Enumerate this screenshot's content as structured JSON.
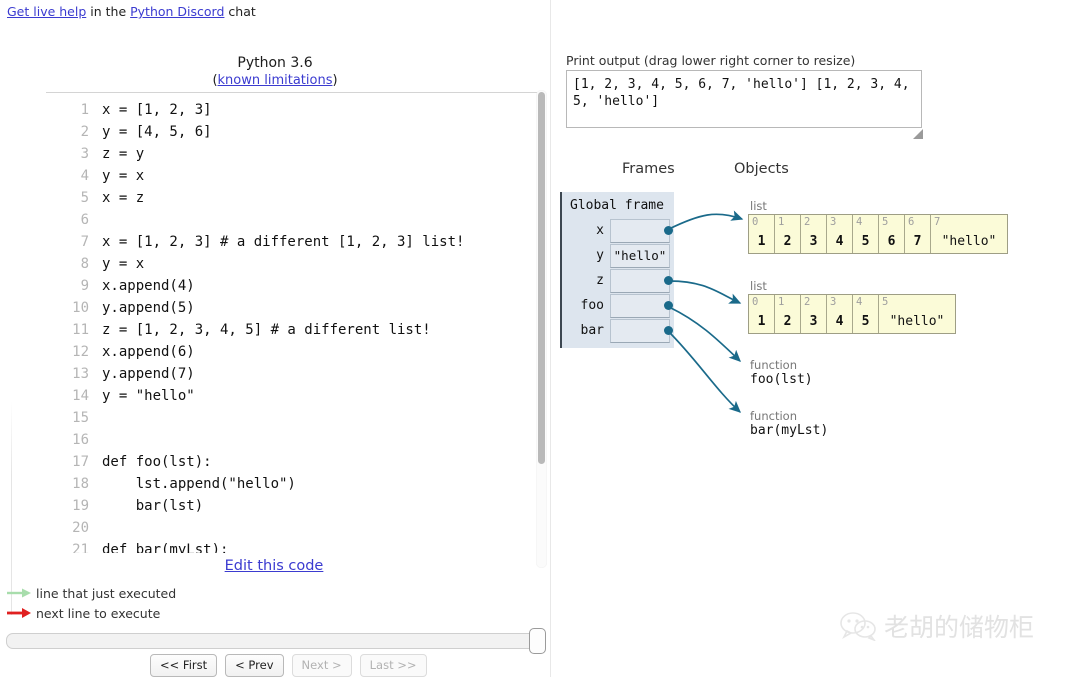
{
  "help_bar": {
    "link1": "Get live help",
    "mid": " in the ",
    "link2": "Python Discord",
    "tail": " chat"
  },
  "code_header": {
    "version": "Python 3.6",
    "limits_open": "(",
    "limits_link": "known limitations",
    "limits_close": ")"
  },
  "code": {
    "lines": [
      {
        "n": "1",
        "text": "x = [1, 2, 3]"
      },
      {
        "n": "2",
        "text": "y = [4, 5, 6]"
      },
      {
        "n": "3",
        "text": "z = y"
      },
      {
        "n": "4",
        "text": "y = x"
      },
      {
        "n": "5",
        "text": "x = z"
      },
      {
        "n": "6",
        "text": ""
      },
      {
        "n": "7",
        "text": "x = [1, 2, 3] # a different [1, 2, 3] list!"
      },
      {
        "n": "8",
        "text": "y = x"
      },
      {
        "n": "9",
        "text": "x.append(4)"
      },
      {
        "n": "10",
        "text": "y.append(5)"
      },
      {
        "n": "11",
        "text": "z = [1, 2, 3, 4, 5] # a different list!"
      },
      {
        "n": "12",
        "text": "x.append(6)"
      },
      {
        "n": "13",
        "text": "y.append(7)"
      },
      {
        "n": "14",
        "text": "y = \"hello\""
      },
      {
        "n": "15",
        "text": ""
      },
      {
        "n": "16",
        "text": ""
      },
      {
        "n": "17",
        "text": "def foo(lst):"
      },
      {
        "n": "18",
        "text": "    lst.append(\"hello\")"
      },
      {
        "n": "19",
        "text": "    bar(lst)"
      },
      {
        "n": "20",
        "text": ""
      },
      {
        "n": "21",
        "text": "def bar(myLst):"
      }
    ]
  },
  "edit_link": "Edit this code",
  "legend": {
    "just_executed": "line that just executed",
    "next_line": "next line to execute",
    "just_executed_color": "#a8ddac",
    "next_line_color": "#e02020"
  },
  "nav": {
    "first": "<< First",
    "prev": "< Prev",
    "next": "Next >",
    "last": "Last >>"
  },
  "print_output": {
    "label": "Print output (drag lower right corner to resize)",
    "text": "[1, 2, 3, 4, 5, 6, 7, 'hello']\n[1, 2, 3, 4, 5, 'hello']"
  },
  "headings": {
    "frames": "Frames",
    "objects": "Objects"
  },
  "global_frame": {
    "title": "Global frame",
    "vars": [
      {
        "name": "x",
        "value": "",
        "is_pointer": true
      },
      {
        "name": "y",
        "value": "\"hello\"",
        "is_pointer": false
      },
      {
        "name": "z",
        "value": "",
        "is_pointer": true
      },
      {
        "name": "foo",
        "value": "",
        "is_pointer": true
      },
      {
        "name": "bar",
        "value": "",
        "is_pointer": true
      }
    ]
  },
  "objects": [
    {
      "kind": "list",
      "label": "list",
      "cells": [
        {
          "idx": "0",
          "val": "1",
          "str": false
        },
        {
          "idx": "1",
          "val": "2",
          "str": false
        },
        {
          "idx": "2",
          "val": "3",
          "str": false
        },
        {
          "idx": "3",
          "val": "4",
          "str": false
        },
        {
          "idx": "4",
          "val": "5",
          "str": false
        },
        {
          "idx": "5",
          "val": "6",
          "str": false
        },
        {
          "idx": "6",
          "val": "7",
          "str": false
        },
        {
          "idx": "7",
          "val": "\"hello\"",
          "str": true
        }
      ]
    },
    {
      "kind": "list",
      "label": "list",
      "cells": [
        {
          "idx": "0",
          "val": "1",
          "str": false
        },
        {
          "idx": "1",
          "val": "2",
          "str": false
        },
        {
          "idx": "2",
          "val": "3",
          "str": false
        },
        {
          "idx": "3",
          "val": "4",
          "str": false
        },
        {
          "idx": "4",
          "val": "5",
          "str": false
        },
        {
          "idx": "5",
          "val": "\"hello\"",
          "str": true
        }
      ]
    }
  ],
  "functions": [
    {
      "type": "function",
      "signature": "foo(lst)"
    },
    {
      "type": "function",
      "signature": "bar(myLst)"
    }
  ],
  "colors": {
    "link": "#3b3bd0",
    "arrow": "#1a6a8a",
    "frame_bg": "#dde5ee",
    "heap_bg": "#fbfbd8"
  },
  "watermark": {
    "text": "老胡的储物柜"
  }
}
